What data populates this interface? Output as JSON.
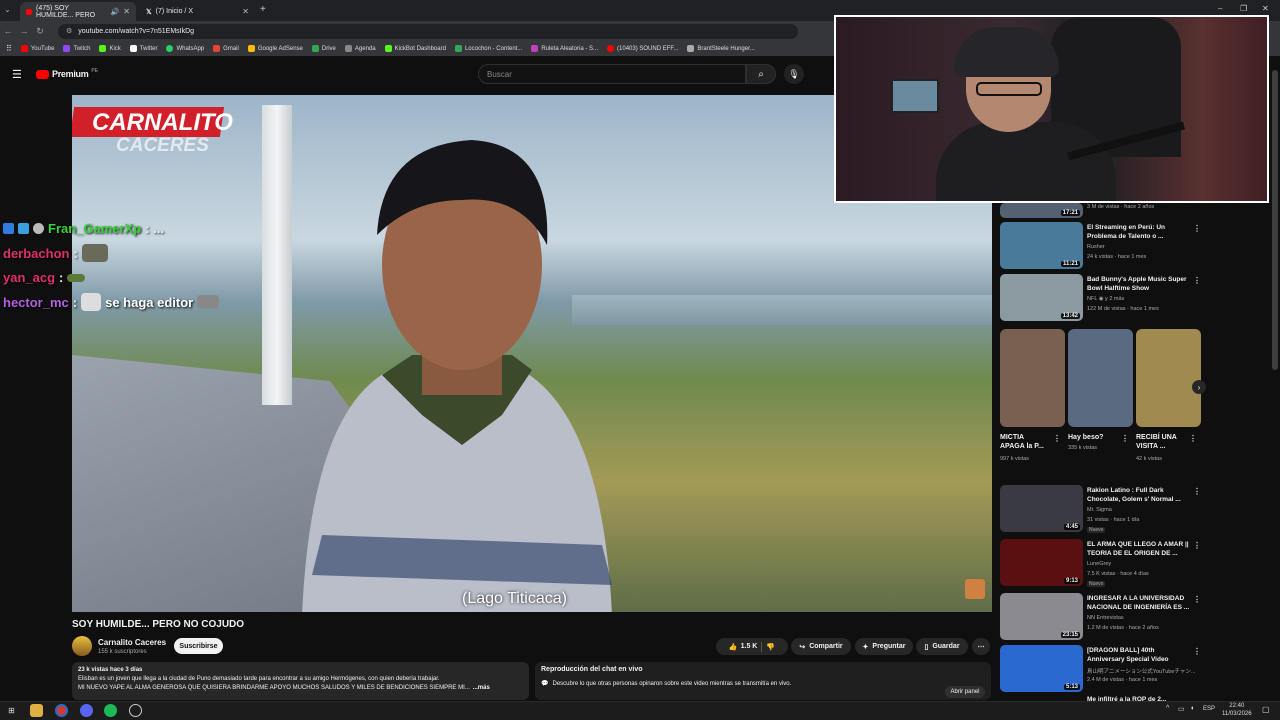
{
  "browser": {
    "tabs": [
      {
        "title": "(475) SOY HUMILDE... PERO"
      },
      {
        "title": "(7) Inicio / X"
      }
    ],
    "url": "youtube.com/watch?v=7n51EMsIkDg",
    "bookmarks": [
      "YouTube",
      "Twitch",
      "Kick",
      "Twitter",
      "WhatsApp",
      "Gmail",
      "Google AdSense",
      "Drive",
      "Agenda",
      "KickBot Dashboard",
      "Locochon - Content...",
      "Ruleta Aleatoria - S...",
      "(10403) SOUND EFF...",
      "BrantSteele Hunger..."
    ]
  },
  "youtube": {
    "logo": "Premium",
    "logo_sup": "PE",
    "search_placeholder": "Buscar"
  },
  "video": {
    "overlay_logo_line1": "CARNALITO",
    "overlay_logo_line2": "CACERES",
    "subtitle": "(Lago Titicaca)",
    "title": "SOY HUMILDE... PERO NO COJUDO",
    "channel": "Carnalito Caceres",
    "subscribers": "155 k suscriptores",
    "subscribe_label": "Suscribirse",
    "likes": "1.5 K",
    "share_label": "Compartir",
    "ask_label": "Preguntar",
    "save_label": "Guardar",
    "desc_meta": "23 k vistas  hace 3 días",
    "desc_line1": "Elisban es un joven que llega a la ciudad de Puno demasiado tarde para encontrar a su amigo Hermógenes, con quien debería trabajar.",
    "desc_line2": "MI NUEVO YAPE AL ALMA GENEROSA QUE QUISIERA BRINDARME APOYO MUCHOS SALUDOS Y MILES DE BENDICIONES SIEMPRE MI...",
    "desc_more": "...más"
  },
  "chat_replay": {
    "title": "Reproducción del chat en vivo",
    "text": "Descubre lo que otras personas opinaron sobre este video mientras se transmitía en vivo.",
    "open_label": "Abrir panel"
  },
  "stream_chat": [
    {
      "user": "Fran_GamerXp",
      "color": "#3ad13a",
      "message": "..."
    },
    {
      "user": "derbachon",
      "color": "#e0306a",
      "message": ""
    },
    {
      "user": "yan_acg",
      "color": "#e0306a",
      "message": ""
    },
    {
      "user": "hector_mc",
      "color": "#b060e0",
      "message": "se haga editor"
    }
  ],
  "sidebar": {
    "top_partial": {
      "duration": "17:21",
      "meta": "3 M de vistas · hace 2 años"
    },
    "videos_a": [
      {
        "title1": "El Streaming en Perú: Un",
        "title2": "Problema de Talento o ...",
        "channel": "Rusher",
        "meta": "24 k vistas · hace 1 mes",
        "duration": "11:21",
        "color": "#4a7a9a"
      },
      {
        "title1": "Bad Bunny's Apple Music Super",
        "title2": "Bowl Halftime Show",
        "channel": "NFL ◉ y 2 más",
        "meta": "122 M de vistas · hace 1 mes",
        "duration": "13:42",
        "color": "#8a9aa0"
      }
    ],
    "shorts": [
      {
        "title1": "MICTIA",
        "title2": "APAGA la P...",
        "views": "997 k vistas",
        "color": "#7a6050"
      },
      {
        "title1": "Hay beso?",
        "title2": "",
        "views": "335 k vistas",
        "color": "#5a6a80"
      },
      {
        "title1": "RECIBÍ UNA",
        "title2": "VISITA ...",
        "views": "42 k vistas",
        "color": "#a08a50"
      }
    ],
    "videos_b": [
      {
        "title1": "Rakion Latino : Full Dark",
        "title2": "Chocolate, Golem s' Normal ...",
        "channel": "Mr. Sigma",
        "meta": "31 vistas · hace 1 día",
        "badge": "Nuevo",
        "duration": "4:45",
        "color": "#3a3a42"
      },
      {
        "title1": "EL ARMA QUE LLEGO A AMAR ||",
        "title2": "TEORIA DE EL ORIGEN DE ...",
        "channel": "LuneGrey",
        "meta": "7.5 K vistas · hace 4 días",
        "badge": "Nuevo",
        "duration": "9:13",
        "color": "#5a1010"
      },
      {
        "title1": "INGRESAR A LA UNIVERSIDAD",
        "title2": "NACIONAL DE INGENIERÍA ES ...",
        "channel": "NN Entrevistas",
        "meta": "1.2 M de vistas · hace 2 años",
        "badge": "",
        "duration": "23:15",
        "color": "#8a8a90"
      },
      {
        "title1": "[DRAGON BALL] 40th",
        "title2": "Anniversary Special Video",
        "channel": "鳥山明アニメーション公式YouTubeチャン...",
        "meta": "2.4 M de vistas · hace 1 mes",
        "badge": "",
        "duration": "5:13",
        "color": "#2a6ad0"
      }
    ],
    "bottom_partial": "Me infiltré a la ROP de 2..."
  },
  "taskbar": {
    "lang": "ESP",
    "time": "22:40",
    "date": "11/03/2026"
  }
}
